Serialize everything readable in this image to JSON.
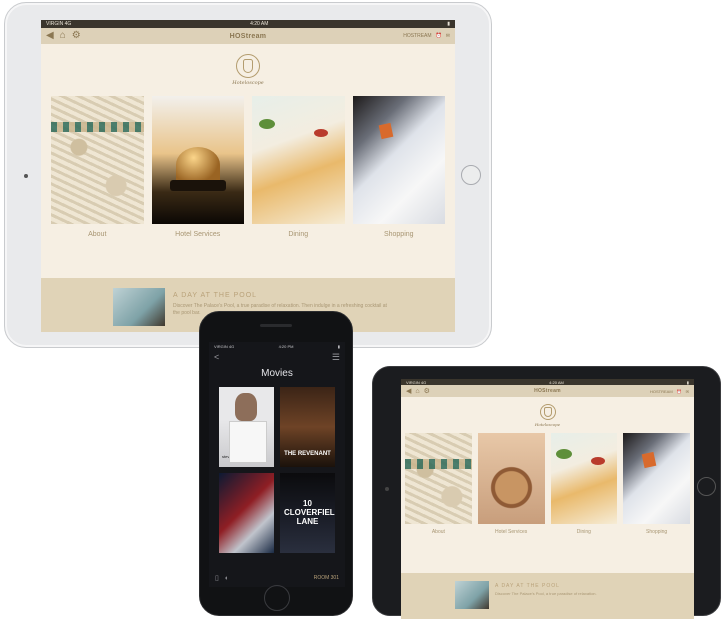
{
  "large_ipad": {
    "status": {
      "carrier": "VIRGIN 4G",
      "time": "4:20 AM",
      "battery": "▮"
    },
    "navbar": {
      "title": "HOStream",
      "right_label": "HOSTREAM"
    },
    "logo_text": "Hoteloscope",
    "tiles": [
      {
        "label": "About"
      },
      {
        "label": "Hotel Services"
      },
      {
        "label": "Dining"
      },
      {
        "label": "Shopping"
      }
    ],
    "promo": {
      "title": "A DAY AT THE POOL",
      "text": "Discover The Palace's Pool, a true paradise of relaxation. Then indulge in a refreshing cocktail at the pool bar."
    }
  },
  "small_ipad": {
    "status": {
      "carrier": "VIRGIN 4G",
      "time": "4:20 AM",
      "battery": "▮"
    },
    "navbar": {
      "title": "HOStream",
      "right_label": "HOSTREAM"
    },
    "logo_text": "Hoteloscope",
    "tiles": [
      {
        "label": "About"
      },
      {
        "label": "Hotel Services"
      },
      {
        "label": "Dining"
      },
      {
        "label": "Shopping"
      }
    ],
    "promo": {
      "title": "A DAY AT THE POOL",
      "text": "Discover The Palace's Pool, a true paradise of relaxation."
    }
  },
  "iphone": {
    "status": {
      "carrier": "VIRGIN 4G",
      "time": "4:20 PM",
      "battery": "▮"
    },
    "nav": {
      "back": "<",
      "menu": "☰"
    },
    "title": "Movies",
    "posters": [
      {
        "name": "Steve Jobs",
        "caption": "steve jobs"
      },
      {
        "name": "The Revenant",
        "caption": "THE REVENANT"
      },
      {
        "name": "Batman v Superman",
        "caption": ""
      },
      {
        "name": "10 Cloverfield Lane",
        "caption": "10 CLOVERFIELD LANE"
      }
    ],
    "bottom": {
      "room": "ROOM 301"
    }
  },
  "colors": {
    "screen_bg": "#f6efe3",
    "navbar_bg": "#ddd1b8",
    "accent_gold": "#8b7752",
    "promo_bg": "#e0d3b7"
  },
  "icons": {
    "back": "back-arrow-icon",
    "home": "home-icon",
    "settings": "settings-icon",
    "alarm": "alarm-clock-icon",
    "mail": "mail-icon"
  }
}
